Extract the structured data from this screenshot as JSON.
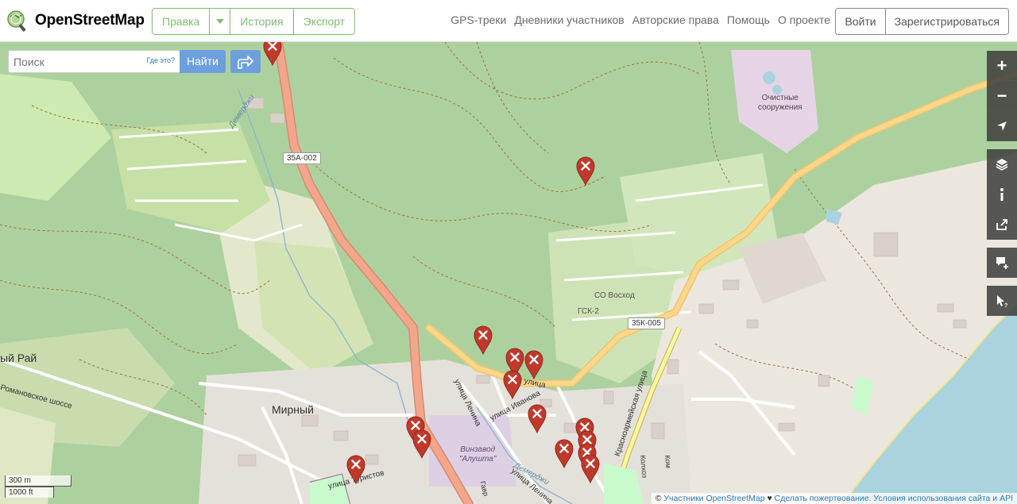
{
  "header": {
    "logo_text": "OpenStreetMap",
    "edit_label": "Правка",
    "history_label": "История",
    "export_label": "Экспорт",
    "nav": [
      "GPS-треки",
      "Дневники участников",
      "Авторские права",
      "Помощь",
      "О проекте"
    ],
    "login_label": "Войти",
    "signup_label": "Зарегистрироваться"
  },
  "search": {
    "placeholder": "Поиск",
    "where_label": "Где это?",
    "go_label": "Найти"
  },
  "controls": {
    "zoom_in": "+",
    "zoom_out": "−"
  },
  "scale": {
    "metric": "300 m",
    "imperial": "1000 ft"
  },
  "attribution": {
    "prefix": "©",
    "contributors": "Участники OpenStreetMap",
    "heart": "♥",
    "donate": "Сделать пожертвование.",
    "terms": "Условия использования сайта и API"
  },
  "map_labels": {
    "treatment": [
      "Очистные",
      "сооружения"
    ],
    "so_voskhod": "СО Восход",
    "gsk": "ГСК-2",
    "miry": "Мирный",
    "rai": "ый Рай",
    "romanov": "Романовское шоссе",
    "vinzavod": [
      "Винзавод",
      "\"Алушта\""
    ],
    "krasnoarm": "Красноармейская улица",
    "lenina1": "улица Ленина",
    "lenina2": "улица Ленина",
    "ivanova": "улица Иванова",
    "ploskaya": "ская улица",
    "turistov": "улица Туристов",
    "demerji": "Демерджи",
    "demerji2": "Демерджи",
    "road_35a": "35А-002",
    "road_35k": "35К-005",
    "kolkh": "Колхоз",
    "gavr": "Гавр",
    "kom": "Ком"
  },
  "colors": {
    "brand_green": "#7ebc6f",
    "search_blue": "#6e9fdd",
    "forest": "#add19e",
    "marker": "#c0392b"
  }
}
